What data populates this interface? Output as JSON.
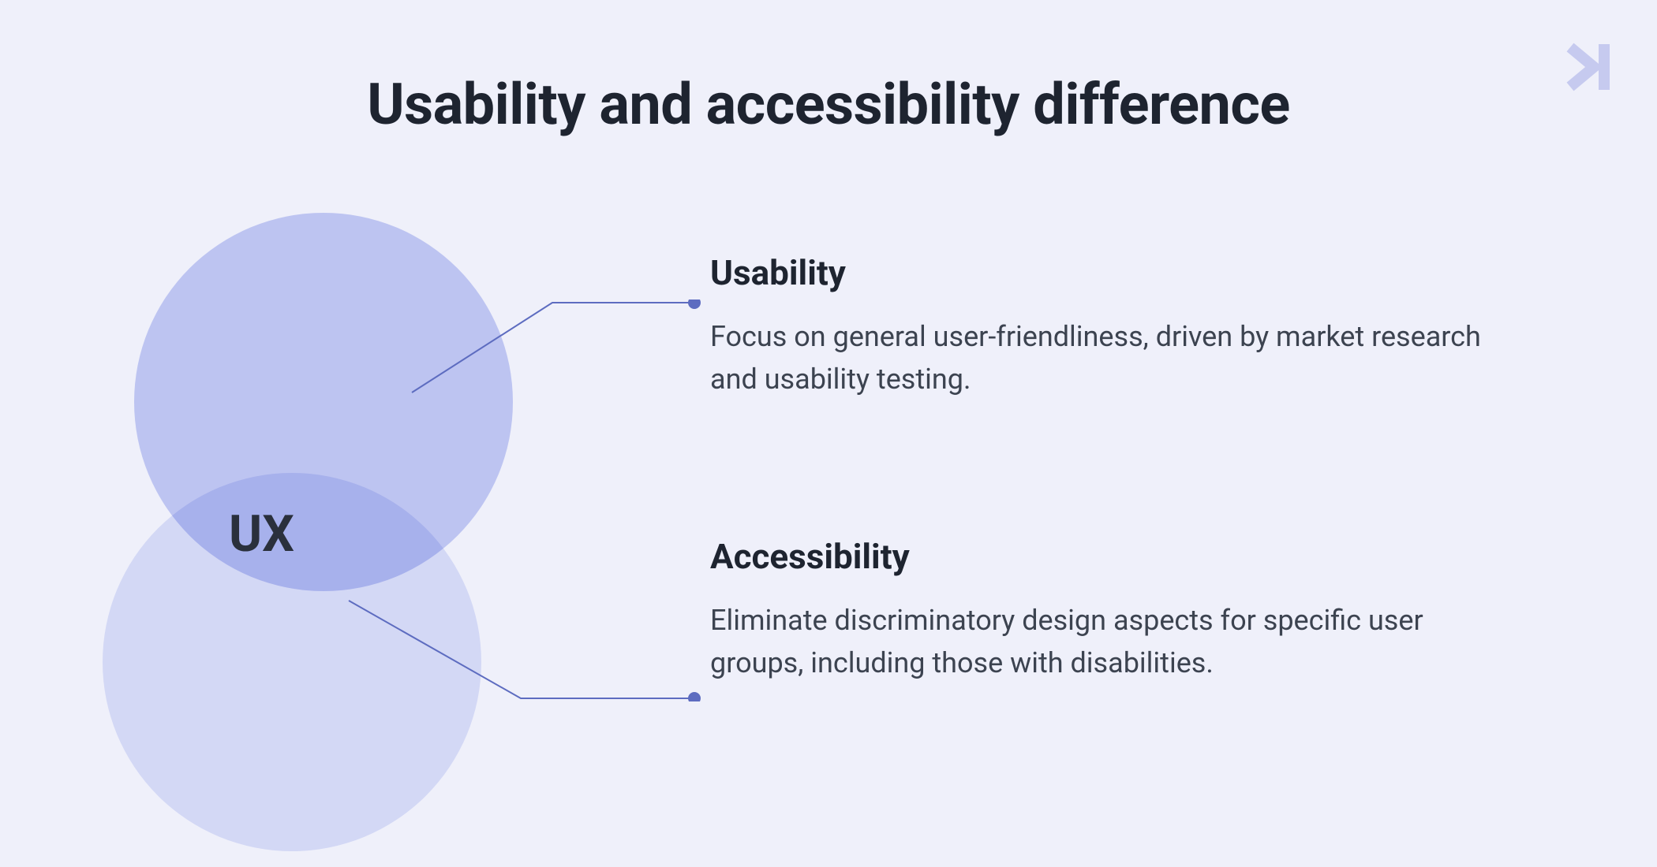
{
  "title": "Usability and accessibility difference",
  "venn": {
    "label": "UX"
  },
  "sections": {
    "usability": {
      "heading": "Usability",
      "body": "Focus on general user-friendliness, driven by market research and usability testing."
    },
    "accessibility": {
      "heading": "Accessibility",
      "body": "Eliminate discriminatory design aspects for specific user groups, including those with disabilities."
    }
  },
  "colors": {
    "background": "#EFF0FA",
    "circleTop": "rgba(123,140,232,0.40)",
    "circleBottom": "rgba(123,140,232,0.22)",
    "connector": "#5D6CC0",
    "text": "#1E2430",
    "logo": "#C6CAEF"
  }
}
